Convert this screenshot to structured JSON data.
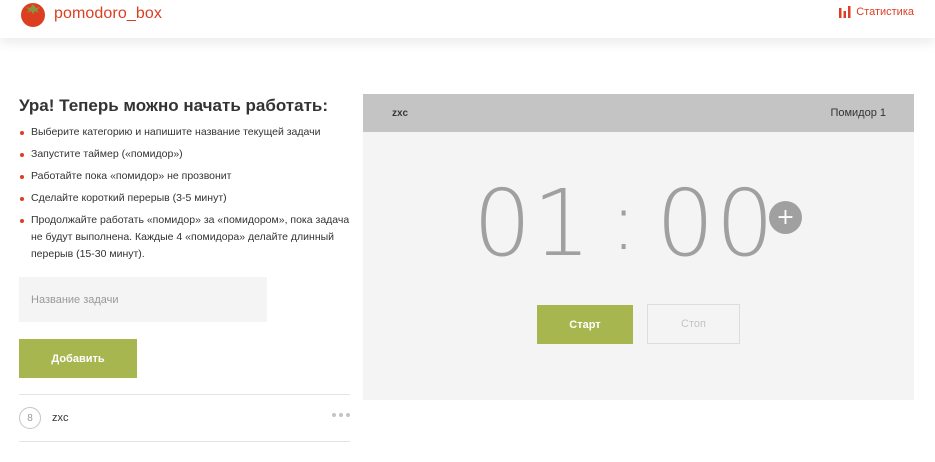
{
  "header": {
    "logo_text": "pomodoro_box",
    "logo_icon": "tomato-icon",
    "stats_label": "Статистика",
    "stats_icon": "bar-chart-icon"
  },
  "colors": {
    "brand_red": "#dc3e22",
    "accent_green": "#a8b64f",
    "panel_grey": "#f4f4f4",
    "header_grey": "#c4c4c4"
  },
  "intro": {
    "title": "Ура! Теперь можно начать работать:",
    "items": [
      "Выберите категорию и напишите название текущей задачи",
      "Запустите таймер («помидор»)",
      "Работайте пока «помидор» не прозвонит",
      "Сделайте короткий перерыв (3-5 минут)",
      "Продолжайте работать «помидор» за «помидором», пока задача не будут выполнена. Каждые 4 «помидора» делайте длинный перерыв (15-30 минут)."
    ]
  },
  "form": {
    "task_placeholder": "Название задачи",
    "add_label": "Добавить"
  },
  "tasks": [
    {
      "count": "8",
      "name": "zxc"
    }
  ],
  "timer": {
    "task_name": "zxc",
    "pomodoro_label": "Помидор 1",
    "minutes": "01",
    "separator": ":",
    "seconds": "00",
    "plus_label": "+",
    "start_label": "Старт",
    "stop_label": "Стоп"
  }
}
